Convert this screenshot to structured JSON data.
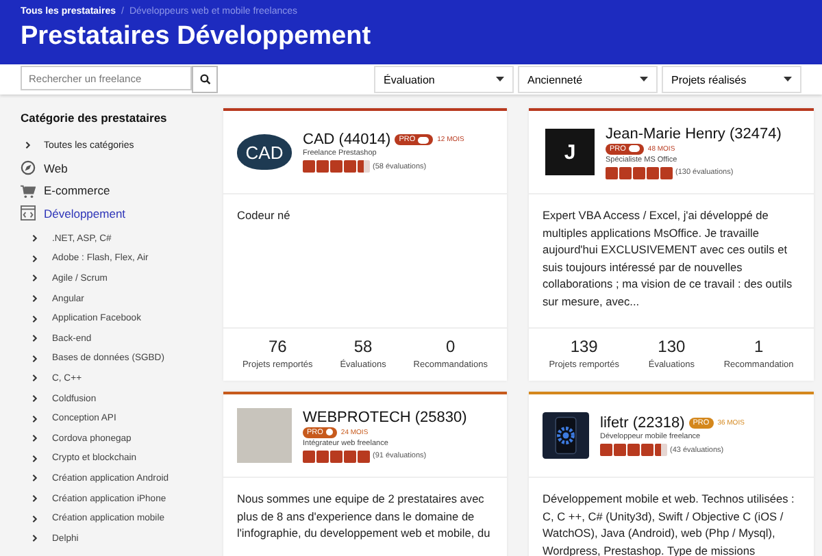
{
  "breadcrumb": [
    {
      "label": "Tous les prestataires",
      "selected": false
    },
    {
      "label": "Développeurs web et mobile freelances",
      "selected": true
    }
  ],
  "breadcrumb_separator": "/",
  "title": "Prestataires Développement",
  "search": {
    "placeholder": "Rechercher un freelance"
  },
  "filters": [
    "Évaluation",
    "Ancienneté",
    "Projets réalisés"
  ],
  "sidebar": {
    "title": "Catégorie des prestataires",
    "top_items": [
      {
        "kind": "chevron",
        "label": "Toutes les catégories",
        "selected": false
      },
      {
        "kind": "compass",
        "label": "Web",
        "selected": false
      },
      {
        "kind": "cart",
        "label": "E-commerce",
        "selected": false
      },
      {
        "kind": "code",
        "label": "Développement",
        "selected": true
      }
    ],
    "children": [
      ".NET, ASP, C#",
      "Adobe : Flash, Flex, Air",
      "Agile / Scrum",
      "Angular",
      "Application Facebook",
      "Back-end",
      "Bases de données (SGBD)",
      "C, C++",
      "Coldfusion",
      "Conception API",
      "Cordova phonegap",
      "Crypto et blockchain",
      "Création application Android",
      "Création application iPhone",
      "Création application mobile",
      "Delphi"
    ]
  },
  "cards": [
    {
      "avatar": {
        "kind": "logo",
        "text": "CAD"
      },
      "name": "CAD (44014)",
      "badge": {
        "kind": "pill",
        "label": "PRO"
      },
      "color": "#b83a1f",
      "tenure": "12 MOIS",
      "subtitle": "Freelance Prestashop",
      "stars": 4.5,
      "reviews": "(58 évaluations)",
      "description": "Codeur né",
      "stats": [
        {
          "value": "76",
          "label": "Projets remportés"
        },
        {
          "value": "58",
          "label": "Évaluations"
        },
        {
          "value": "0",
          "label": "Recommandations"
        }
      ]
    },
    {
      "avatar": {
        "kind": "letter",
        "text": "J"
      },
      "name": "Jean-Marie Henry (32474)",
      "badge": {
        "kind": "pill",
        "label": "PRO"
      },
      "color": "#b83a1f",
      "tenure": "48 MOIS",
      "subtitle": "Spécialiste MS Office",
      "stars": 5,
      "reviews": "(130 évaluations)",
      "description": "Expert VBA Access / Excel, j'ai développé de multiples applications MsOffice. Je travaille aujourd'hui EXCLUSIVEMENT avec ces outils et suis toujours intéressé par de nouvelles collaborations ; ma vision de ce travail : des outils sur mesure, avec...",
      "stats": [
        {
          "value": "139",
          "label": "Projets remportés"
        },
        {
          "value": "130",
          "label": "Évaluations"
        },
        {
          "value": "1",
          "label": "Recommandation"
        }
      ]
    },
    {
      "avatar": {
        "kind": "photo"
      },
      "name": "WEBPROTECH (25830)",
      "badge": {
        "kind": "dot",
        "label": "PRO"
      },
      "color": "#c75a1c",
      "tenure": "24 MOIS",
      "subtitle": "Intégrateur web freelance",
      "stars": 5,
      "reviews": "(91 évaluations)",
      "description": "Nous sommes une equipe de 2 prestataires avec plus de 8 ans d'experience dans le domaine de l'infographie, du developpement web et mobile, du"
    },
    {
      "avatar": {
        "kind": "phone"
      },
      "name": "lifetr (22318)",
      "badge": {
        "kind": "plain",
        "label": "PRO"
      },
      "color": "#d4871c",
      "tenure": "36 MOIS",
      "subtitle": "Développeur mobile freelance",
      "stars": 4.5,
      "reviews": "(43 évaluations)",
      "description": "Développement mobile et web. Technos utilisées : C, C ++, C# (Unity3d), Swift / Objective C (iOS / WatchOS), Java (Android), web (Php / Mysql), Wordpress, Prestashop. Type de missions"
    }
  ]
}
